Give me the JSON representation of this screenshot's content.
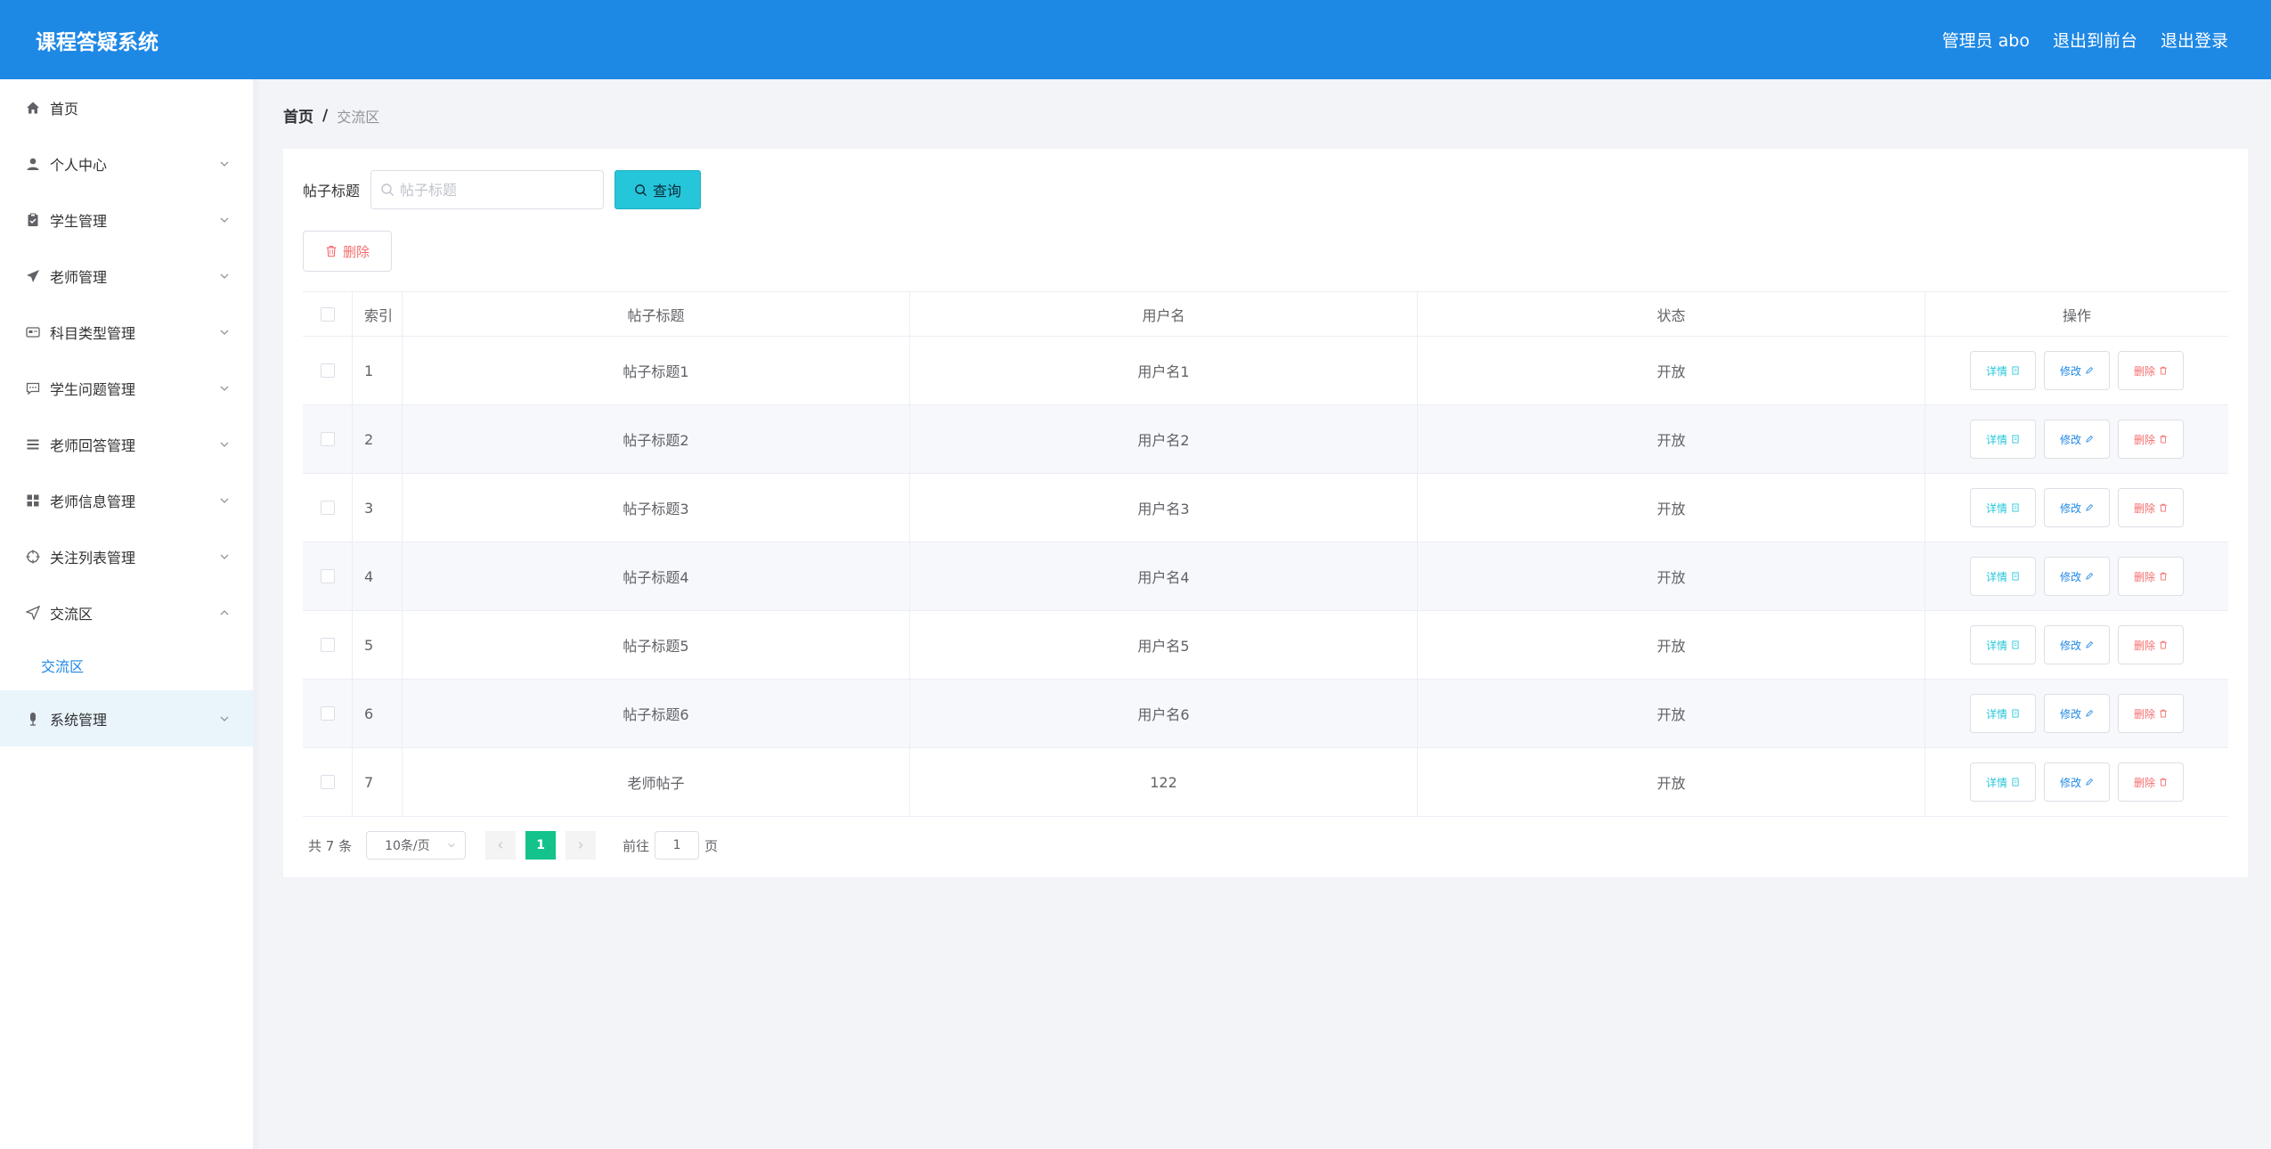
{
  "app": {
    "title": "课程答疑系统"
  },
  "header": {
    "user_label": "管理员 abo",
    "to_front": "退出到前台",
    "logout": "退出登录"
  },
  "sidebar": {
    "items": [
      {
        "label": "首页",
        "icon": "home-icon"
      },
      {
        "label": "个人中心",
        "icon": "user-icon"
      },
      {
        "label": "学生管理",
        "icon": "clipboard-icon"
      },
      {
        "label": "老师管理",
        "icon": "send-icon"
      },
      {
        "label": "科目类型管理",
        "icon": "card-icon"
      },
      {
        "label": "学生问题管理",
        "icon": "chat-icon"
      },
      {
        "label": "老师回答管理",
        "icon": "list-icon"
      },
      {
        "label": "老师信息管理",
        "icon": "grid-icon"
      },
      {
        "label": "关注列表管理",
        "icon": "target-icon"
      },
      {
        "label": "交流区",
        "icon": "navigation-icon"
      },
      {
        "label": "系统管理",
        "icon": "mic-icon"
      }
    ],
    "sub_item": "交流区"
  },
  "breadcrumb": {
    "home": "首页",
    "sep": "/",
    "current": "交流区"
  },
  "search": {
    "label": "帖子标题",
    "placeholder": "帖子标题",
    "button": "查询"
  },
  "toolbar": {
    "delete_label": "删除"
  },
  "table": {
    "headers": {
      "index": "索引",
      "title": "帖子标题",
      "username": "用户名",
      "status": "状态",
      "ops": "操作"
    },
    "rows": [
      {
        "index": "1",
        "title": "帖子标题1",
        "username": "用户名1",
        "status": "开放"
      },
      {
        "index": "2",
        "title": "帖子标题2",
        "username": "用户名2",
        "status": "开放"
      },
      {
        "index": "3",
        "title": "帖子标题3",
        "username": "用户名3",
        "status": "开放"
      },
      {
        "index": "4",
        "title": "帖子标题4",
        "username": "用户名4",
        "status": "开放"
      },
      {
        "index": "5",
        "title": "帖子标题5",
        "username": "用户名5",
        "status": "开放"
      },
      {
        "index": "6",
        "title": "帖子标题6",
        "username": "用户名6",
        "status": "开放"
      },
      {
        "index": "7",
        "title": "老师帖子",
        "username": "122",
        "status": "开放"
      }
    ],
    "ops": {
      "detail": "详情",
      "edit": "修改",
      "delete": "删除"
    }
  },
  "pagination": {
    "total": "共 7 条",
    "page_size": "10条/页",
    "current_page": "1",
    "goto_label": "前往",
    "goto_value": "1",
    "page_unit": "页"
  },
  "colors": {
    "header_bg": "#1e88e5",
    "query_button": "#26c6da",
    "active_page": "#13c38b",
    "danger": "#f56c6c"
  }
}
